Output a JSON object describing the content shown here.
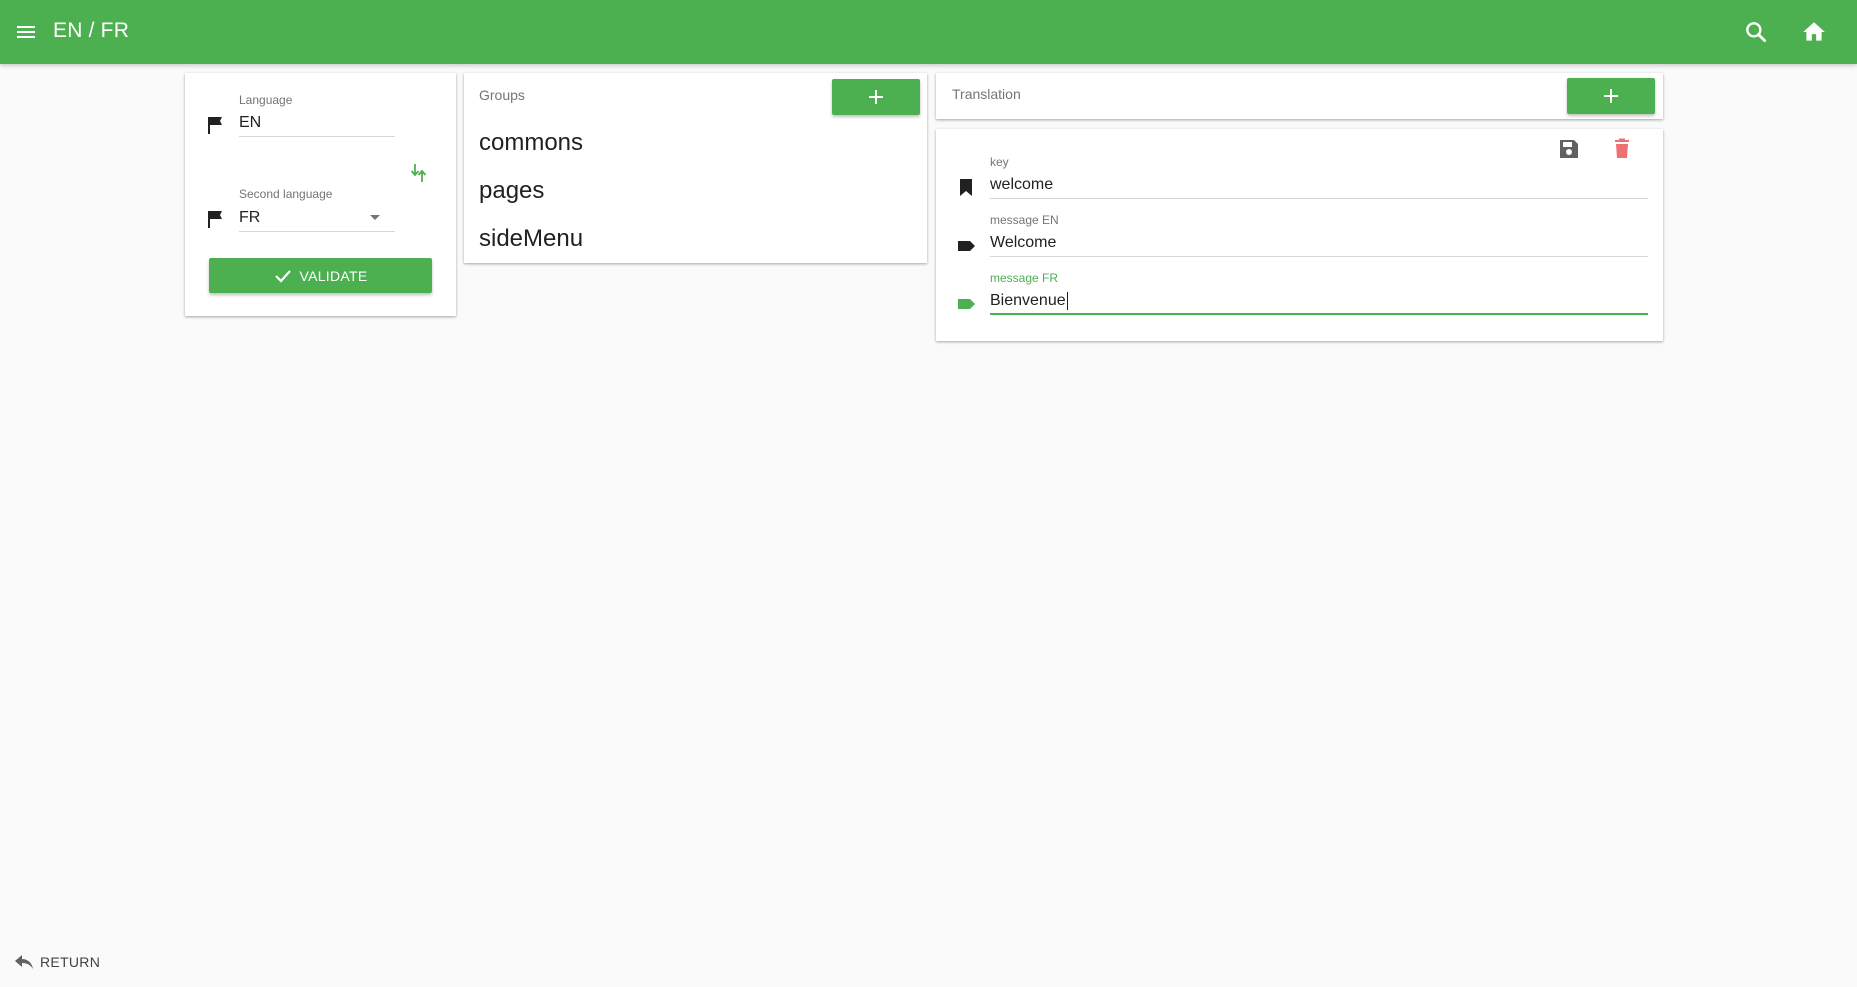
{
  "app": {
    "title": "EN / FR"
  },
  "colors": {
    "primary": "#4caf50",
    "delete": "#ef5350",
    "background": "#fafafa"
  },
  "language_card": {
    "language_label": "Language",
    "language_value": "EN",
    "second_language_label": "Second language",
    "second_language_value": "FR",
    "validate_label": "VALIDATE"
  },
  "groups_card": {
    "heading": "Groups",
    "add_icon": "plus-icon",
    "items": [
      {
        "label": "commons"
      },
      {
        "label": "pages"
      },
      {
        "label": "sideMenu"
      }
    ]
  },
  "translation_card": {
    "heading": "Translation",
    "add_icon": "plus-icon",
    "save_icon": "floppy-disk-icon",
    "delete_icon": "trash-icon",
    "fields": {
      "key_label": "key",
      "key_value": "welcome",
      "message_en_label": "message EN",
      "message_en_value": "Welcome",
      "message_fr_label": "message FR",
      "message_fr_value": "Bienvenue"
    }
  },
  "footer": {
    "return_label": "RETURN"
  }
}
